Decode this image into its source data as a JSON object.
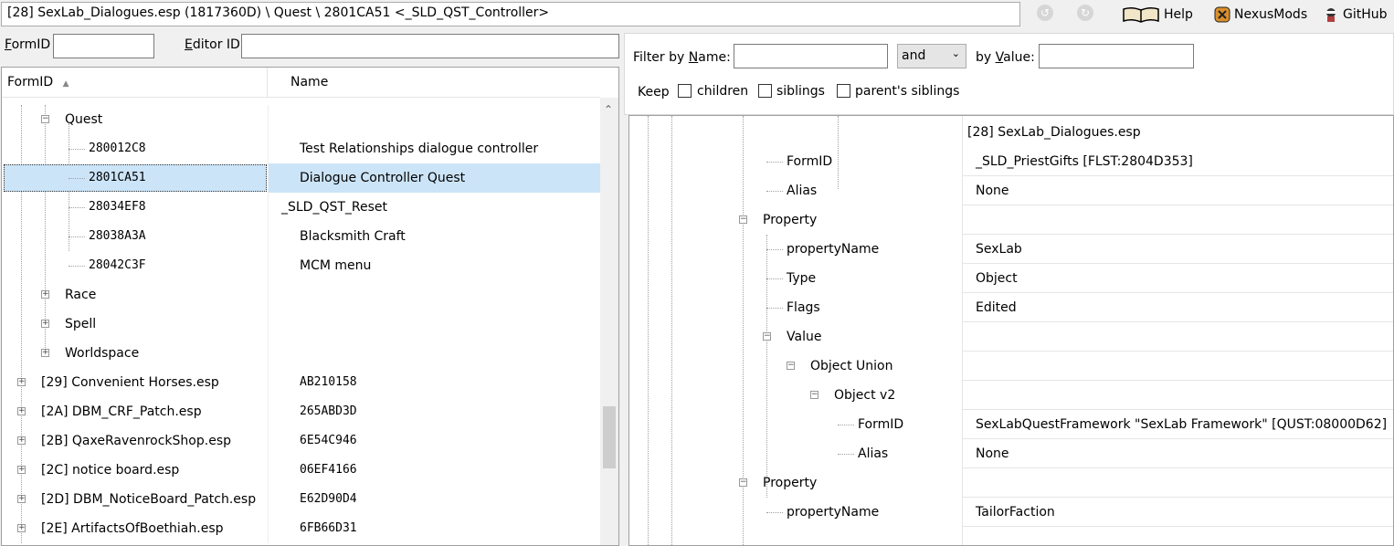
{
  "topbar": {
    "path": "[28] SexLab_Dialogues.esp (1817360D) \\ Quest \\ 2801CA51 <_SLD_QST_Controller>",
    "help_label": "Help",
    "nexus_label": "NexusMods",
    "github_label": "GitHub",
    "back_icon": "back-arrow-icon",
    "forward_icon": "forward-arrow-icon"
  },
  "left": {
    "formid_label": "FormID",
    "editorid_label": "Editor ID",
    "formid_value": "",
    "editorid_value": "",
    "columns": [
      "FormID",
      "Name"
    ],
    "tree": [
      {
        "id": "Quest",
        "name": "",
        "depth": 1,
        "expander": "minus"
      },
      {
        "id": "280012C8",
        "name": "Test Relationships dialogue controller",
        "depth": 2,
        "mono": true
      },
      {
        "id": "2801CA51",
        "name": "Dialogue Controller Quest",
        "depth": 2,
        "mono": true,
        "selected": true
      },
      {
        "id": "28034EF8",
        "name": "_SLD_QST_Reset",
        "depth": 2,
        "mono": true
      },
      {
        "id": "28038A3A",
        "name": "Blacksmith Craft",
        "depth": 2,
        "mono": true
      },
      {
        "id": "28042C3F",
        "name": "MCM menu",
        "depth": 2,
        "mono": true
      },
      {
        "id": "Race",
        "name": "",
        "depth": 1,
        "expander": "plus"
      },
      {
        "id": "Spell",
        "name": "",
        "depth": 1,
        "expander": "plus"
      },
      {
        "id": "Worldspace",
        "name": "",
        "depth": 1,
        "expander": "plus"
      },
      {
        "id": "[29] Convenient Horses.esp",
        "name": "AB210158",
        "depth": 0,
        "expander": "plus",
        "namemono": true
      },
      {
        "id": "[2A] DBM_CRF_Patch.esp",
        "name": "265ABD3D",
        "depth": 0,
        "expander": "plus",
        "namemono": true
      },
      {
        "id": "[2B] QaxeRavenrockShop.esp",
        "name": "6E54C946",
        "depth": 0,
        "expander": "plus",
        "namemono": true
      },
      {
        "id": "[2C] notice board.esp",
        "name": "06EF4166",
        "depth": 0,
        "expander": "plus",
        "namemono": true
      },
      {
        "id": "[2D] DBM_NoticeBoard_Patch.esp",
        "name": "E62D90D4",
        "depth": 0,
        "expander": "plus",
        "namemono": true
      },
      {
        "id": "[2E] ArtifactsOfBoethiah.esp",
        "name": "6FB66D31",
        "depth": 0,
        "expander": "plus",
        "namemono": true
      }
    ]
  },
  "right": {
    "filter_name_label": "Filter by Name:",
    "filter_name_value": "",
    "operator": "and",
    "filter_value_label": "by Value:",
    "filter_value_value": "",
    "keep_label": "Keep",
    "keep_children": "children",
    "keep_siblings": "siblings",
    "keep_parents": "parent's siblings",
    "header_value": "[28] SexLab_Dialogues.esp",
    "rows": [
      {
        "key": "FormID",
        "value": "_SLD_PriestGifts [FLST:2804D353]",
        "depth": 4
      },
      {
        "key": "Alias",
        "value": "None",
        "depth": 4
      },
      {
        "key": "Property",
        "value": "",
        "depth": 3,
        "expander": "minus"
      },
      {
        "key": "propertyName",
        "value": "SexLab",
        "depth": 4
      },
      {
        "key": "Type",
        "value": "Object",
        "depth": 4
      },
      {
        "key": "Flags",
        "value": "Edited",
        "depth": 4
      },
      {
        "key": "Value",
        "value": "",
        "depth": 4,
        "expander": "minus"
      },
      {
        "key": "Object Union",
        "value": "",
        "depth": 5,
        "expander": "minus"
      },
      {
        "key": "Object v2",
        "value": "",
        "depth": 6,
        "expander": "minus"
      },
      {
        "key": "FormID",
        "value": "SexLabQuestFramework \"SexLab Framework\" [QUST:08000D62]",
        "depth": 7
      },
      {
        "key": "Alias",
        "value": "None",
        "depth": 7
      },
      {
        "key": "Property",
        "value": "",
        "depth": 3,
        "expander": "minus"
      },
      {
        "key": "propertyName",
        "value": "TailorFaction",
        "depth": 4
      }
    ]
  }
}
